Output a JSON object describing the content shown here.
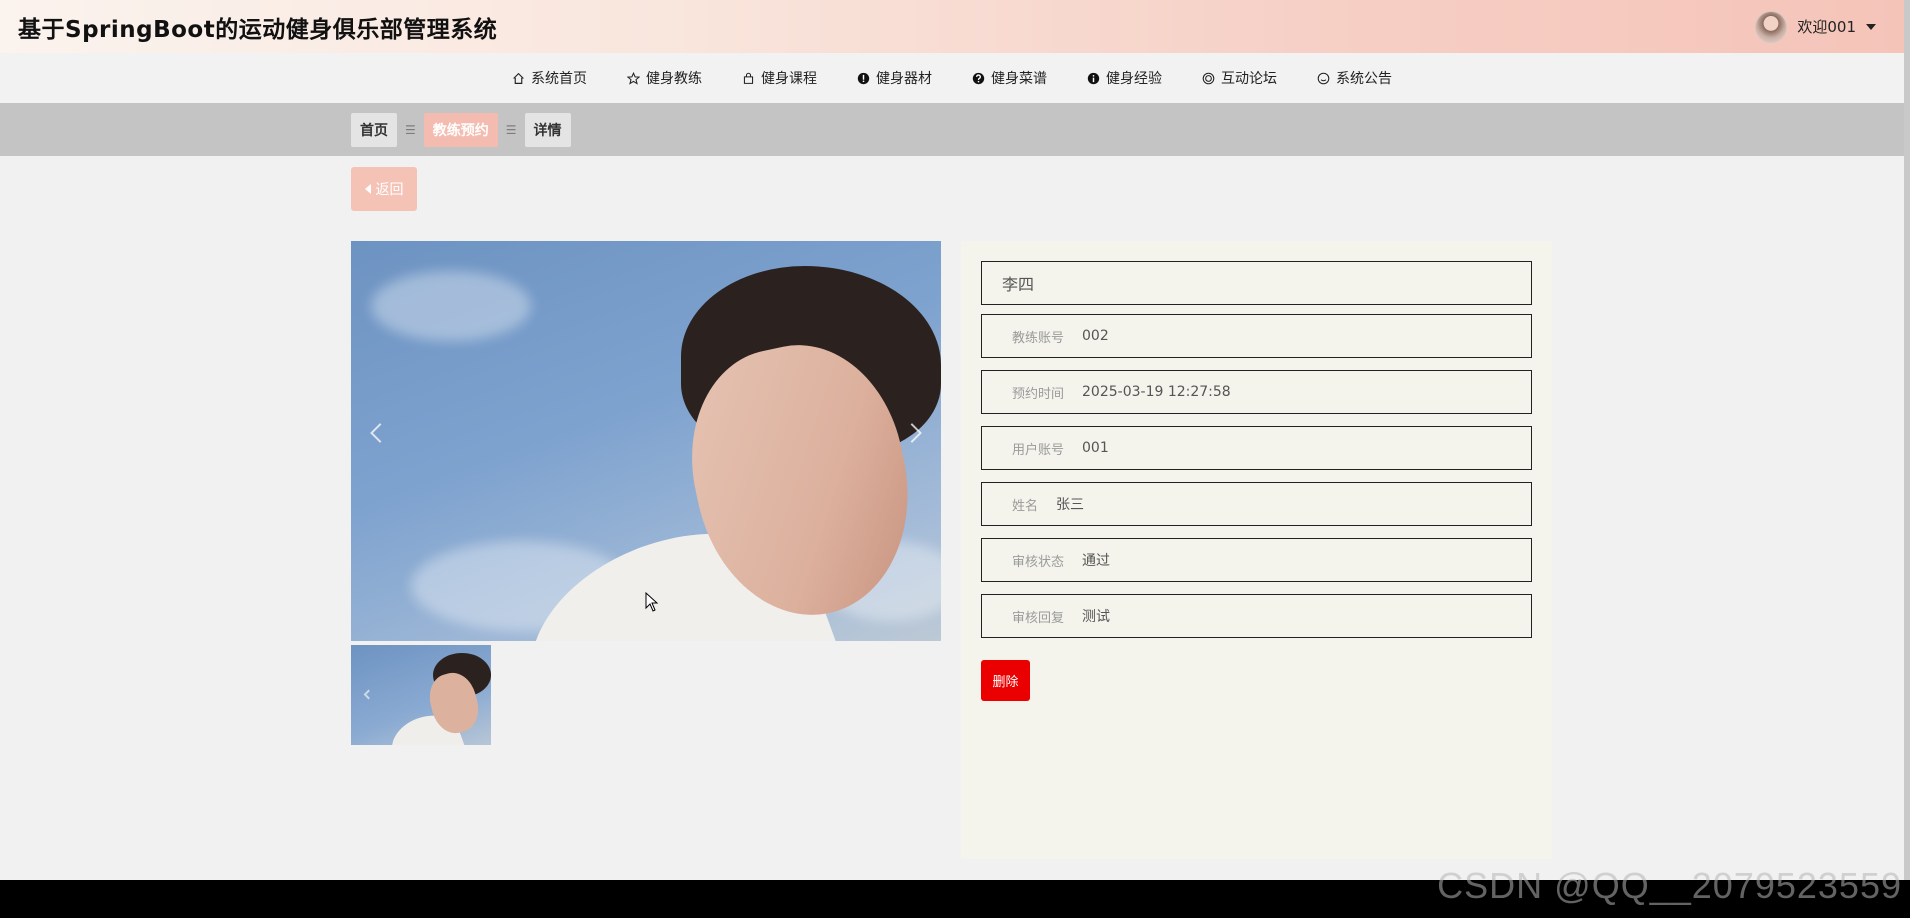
{
  "header": {
    "title": "基于SpringBoot的运动健身俱乐部管理系统",
    "welcome": "欢迎001",
    "brand_gradient": [
      "#fbf3ee",
      "#f5c4b9"
    ]
  },
  "nav": {
    "items": [
      {
        "label": "系统首页",
        "icon": "home-icon"
      },
      {
        "label": "健身教练",
        "icon": "star-icon"
      },
      {
        "label": "健身课程",
        "icon": "bag-icon"
      },
      {
        "label": "健身器材",
        "icon": "exclamation-icon"
      },
      {
        "label": "健身菜谱",
        "icon": "question-icon"
      },
      {
        "label": "健身经验",
        "icon": "info-icon"
      },
      {
        "label": "互动论坛",
        "icon": "target-icon"
      },
      {
        "label": "系统公告",
        "icon": "smile-icon"
      }
    ]
  },
  "breadcrumb": {
    "items": [
      "首页",
      "教练预约",
      "详情"
    ],
    "separator": "☰"
  },
  "back_button": {
    "label": "返回"
  },
  "detail": {
    "title": "李四",
    "fields": [
      {
        "label": "教练账号",
        "value": "002"
      },
      {
        "label": "预约时间",
        "value": "2025-03-19 12:27:58"
      },
      {
        "label": "用户账号",
        "value": "001"
      },
      {
        "label": "姓名",
        "value": "张三"
      },
      {
        "label": "审核状态",
        "value": "通过"
      },
      {
        "label": "审核回复",
        "value": "测试"
      }
    ],
    "delete_label": "删除"
  },
  "watermark": "CSDN @QQ__2079523559",
  "colors": {
    "accent": "#f4bcb0",
    "delete": "#ea0000",
    "panel": "#f4f4ec"
  }
}
